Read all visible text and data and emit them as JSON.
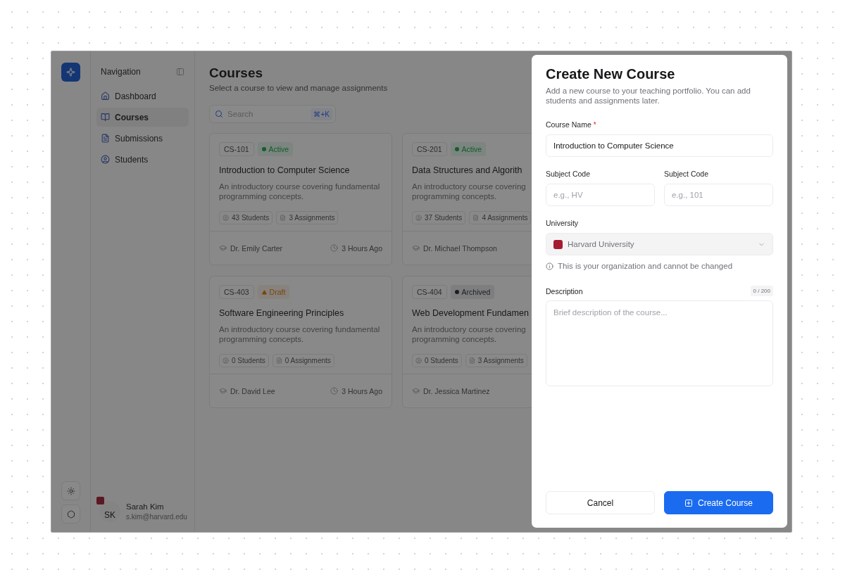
{
  "sidebar": {
    "title": "Navigation",
    "items": [
      {
        "label": "Dashboard",
        "selected": false
      },
      {
        "label": "Courses",
        "selected": true
      },
      {
        "label": "Submissions",
        "selected": false
      },
      {
        "label": "Students",
        "selected": false
      }
    ],
    "user": {
      "initials": "SK",
      "name": "Sarah Kim",
      "email": "s.kim@harvard.edu"
    }
  },
  "page": {
    "title": "Courses",
    "subtitle": "Select a course to view and manage assignments",
    "search": {
      "placeholder": "Search",
      "shortcut": "⌘+K"
    }
  },
  "courses": [
    {
      "code": "CS-101",
      "status": {
        "label": "Active",
        "kind": "active"
      },
      "title": "Introduction to Computer Science",
      "description": "An introductory course covering fundamental programming concepts.",
      "students": "43 Students",
      "assignments": "3 Assignments",
      "instructor": "Dr. Emily Carter",
      "updated": "3 Hours Ago"
    },
    {
      "code": "CS-201",
      "status": {
        "label": "Active",
        "kind": "active"
      },
      "title": "Data Structures and Algorith",
      "description": "An introductory course covering",
      "description_2": "programming concepts.",
      "students": "37 Students",
      "assignments": "4 Assignments",
      "instructor": "Dr. Michael Thompson"
    },
    {
      "code": "CS-403",
      "status": {
        "label": "Draft",
        "kind": "draft"
      },
      "title": "Software Engineering Principles",
      "description": "An introductory course covering fundamental programming concepts.",
      "students": "0 Students",
      "assignments": "0 Assignments",
      "instructor": "Dr. David Lee",
      "updated": "3 Hours Ago"
    },
    {
      "code": "CS-404",
      "status": {
        "label": "Archived",
        "kind": "archived"
      },
      "title": "Web Development Fundamen",
      "description": "An introductory course covering",
      "description_2": "programming concepts.",
      "students": "0 Students",
      "assignments": "3 Assignments",
      "instructor": "Dr. Jessica Martinez"
    }
  ],
  "dialog": {
    "title": "Create New Course",
    "subtitle": "Add a new course to your teaching portfolio. You can add students and assignments later.",
    "course_name": {
      "label": "Course Name",
      "required_mark": "*",
      "value": "Introduction to Computer Science"
    },
    "subject_code": {
      "label": "Subject Code",
      "placeholder": "e.g., HV"
    },
    "subject_number": {
      "label": "Subject Code",
      "placeholder": "e.g., 101"
    },
    "university": {
      "label": "University",
      "value": "Harvard University",
      "disabled": true,
      "hint": "This is your organization and cannot be changed"
    },
    "description": {
      "label": "Description",
      "counter": "0 / 200",
      "placeholder": "Brief description of the course..."
    },
    "buttons": [
      {
        "label": "Cancel",
        "kind": "secondary"
      },
      {
        "label": "Create Course",
        "kind": "primary"
      }
    ]
  }
}
